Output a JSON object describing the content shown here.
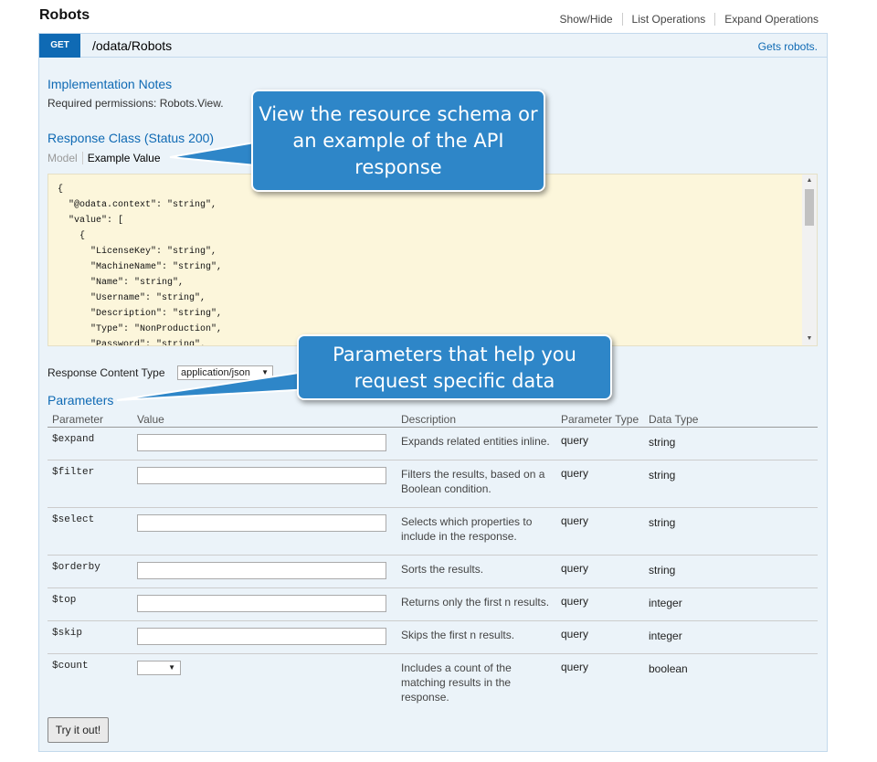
{
  "header": {
    "title": "Robots",
    "links": [
      "Show/Hide",
      "List Operations",
      "Expand Operations"
    ]
  },
  "operation": {
    "method": "GET",
    "path": "/odata/Robots",
    "summary": "Gets robots."
  },
  "implementation": {
    "heading": "Implementation Notes",
    "notes": "Required permissions: Robots.View."
  },
  "response_class": {
    "heading": "Response Class (Status 200)",
    "tab_model": "Model",
    "tab_example": "Example Value",
    "example_lines": [
      "{",
      "  \"@odata.context\": \"string\",",
      "  \"value\": [",
      "    {",
      "      \"LicenseKey\": \"string\",",
      "      \"MachineName\": \"string\",",
      "      \"Name\": \"string\",",
      "      \"Username\": \"string\",",
      "      \"Description\": \"string\",",
      "      \"Type\": \"NonProduction\",",
      "      \"Password\": \"string\","
    ]
  },
  "content_type": {
    "label": "Response Content Type",
    "value": "application/json"
  },
  "parameters": {
    "heading": "Parameters",
    "columns": {
      "parameter": "Parameter",
      "value": "Value",
      "description": "Description",
      "param_type": "Parameter Type",
      "data_type": "Data Type"
    },
    "rows": [
      {
        "name": "$expand",
        "description": "Expands related entities inline.",
        "param_type": "query",
        "data_type": "string"
      },
      {
        "name": "$filter",
        "description": "Filters the results, based on a Boolean condition.",
        "param_type": "query",
        "data_type": "string"
      },
      {
        "name": "$select",
        "description": "Selects which properties to include in the response.",
        "param_type": "query",
        "data_type": "string"
      },
      {
        "name": "$orderby",
        "description": "Sorts the results.",
        "param_type": "query",
        "data_type": "string"
      },
      {
        "name": "$top",
        "description": "Returns only the first n results.",
        "param_type": "query",
        "data_type": "integer"
      },
      {
        "name": "$skip",
        "description": "Skips the first n results.",
        "param_type": "query",
        "data_type": "integer"
      },
      {
        "name": "$count",
        "description": "Includes a count of the matching results in the response.",
        "param_type": "query",
        "data_type": "boolean"
      }
    ]
  },
  "try_button": "Try it out!",
  "callouts": {
    "schema": "View the resource schema or an example of the API response",
    "params": "Parameters that help you request specific data"
  },
  "icons": {
    "select_arrow": "dropdown-arrow-icon",
    "scroll_up": "scroll-up-arrow-icon",
    "scroll_down": "scroll-down-arrow-icon"
  },
  "colors": {
    "method_bg": "#0f6ab4",
    "panel_bg": "#ebf3f9",
    "code_bg": "#fcf6db",
    "callout_bg": "#2e86c8"
  }
}
